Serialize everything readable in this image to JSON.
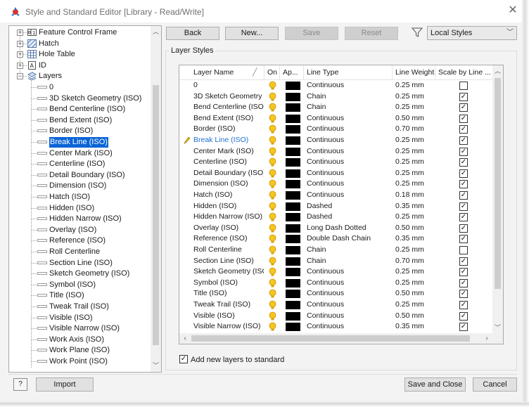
{
  "window": {
    "title": "Style and Standard Editor [Library - Read/Write]",
    "close_glyph": "✕"
  },
  "tree": {
    "groups": [
      {
        "label": "Feature Control Frame",
        "icon": "feature-control-frame-icon"
      },
      {
        "label": "Hatch",
        "icon": "hatch-icon"
      },
      {
        "label": "Hole Table",
        "icon": "hole-table-icon"
      },
      {
        "label": "ID",
        "icon": "id-icon"
      },
      {
        "label": "Layers",
        "icon": "layers-icon"
      }
    ],
    "layer_items": [
      "0",
      "3D Sketch Geometry (ISO)",
      "Bend Centerline (ISO)",
      "Bend Extent (ISO)",
      "Border (ISO)",
      "Break Line (ISO)",
      "Center Mark (ISO)",
      "Centerline (ISO)",
      "Detail Boundary (ISO)",
      "Dimension (ISO)",
      "Hatch (ISO)",
      "Hidden (ISO)",
      "Hidden Narrow (ISO)",
      "Overlay (ISO)",
      "Reference (ISO)",
      "Roll Centerline",
      "Section Line (ISO)",
      "Sketch Geometry (ISO)",
      "Symbol (ISO)",
      "Title (ISO)",
      "Tweak Trail (ISO)",
      "Visible (ISO)",
      "Visible Narrow (ISO)",
      "Work Axis (ISO)",
      "Work Plane (ISO)",
      "Work Point (ISO)"
    ],
    "selected": "Break Line (ISO)"
  },
  "toolbar": {
    "back": "Back",
    "new": "New...",
    "save": "Save",
    "reset": "Reset",
    "filter_value": "Local Styles"
  },
  "layer_styles": {
    "group_label": "Layer Styles",
    "columns": [
      "Layer Name",
      "On",
      "Ap...",
      "Line Type",
      "Line Weight",
      "Scale by Line ..."
    ],
    "active_row": 5,
    "rows": [
      {
        "name": "0",
        "line_type": "Continuous",
        "weight": "0.25 mm",
        "scale": false
      },
      {
        "name": "3D Sketch Geometry (IS",
        "line_type": "Chain",
        "weight": "0.25 mm",
        "scale": true
      },
      {
        "name": "Bend Centerline (ISO)",
        "line_type": "Chain",
        "weight": "0.25 mm",
        "scale": true
      },
      {
        "name": "Bend Extent (ISO)",
        "line_type": "Continuous",
        "weight": "0.50 mm",
        "scale": true
      },
      {
        "name": "Border (ISO)",
        "line_type": "Continuous",
        "weight": "0.70 mm",
        "scale": true
      },
      {
        "name": "Break Line (ISO)",
        "line_type": "Continuous",
        "weight": "0.25 mm",
        "scale": true
      },
      {
        "name": "Center Mark (ISO)",
        "line_type": "Continuous",
        "weight": "0.25 mm",
        "scale": true
      },
      {
        "name": "Centerline (ISO)",
        "line_type": "Continuous",
        "weight": "0.25 mm",
        "scale": true
      },
      {
        "name": "Detail Boundary (ISO)",
        "line_type": "Continuous",
        "weight": "0.25 mm",
        "scale": true
      },
      {
        "name": "Dimension (ISO)",
        "line_type": "Continuous",
        "weight": "0.25 mm",
        "scale": true
      },
      {
        "name": "Hatch (ISO)",
        "line_type": "Continuous",
        "weight": "0.18 mm",
        "scale": true
      },
      {
        "name": "Hidden (ISO)",
        "line_type": "Dashed",
        "weight": "0.35 mm",
        "scale": true
      },
      {
        "name": "Hidden Narrow (ISO)",
        "line_type": "Dashed",
        "weight": "0.25 mm",
        "scale": true
      },
      {
        "name": "Overlay (ISO)",
        "line_type": "Long Dash Dotted",
        "weight": "0.50 mm",
        "scale": true
      },
      {
        "name": "Reference (ISO)",
        "line_type": "Double Dash Chain",
        "weight": "0.35 mm",
        "scale": true
      },
      {
        "name": "Roll Centerline",
        "line_type": "Chain",
        "weight": "0.25 mm",
        "scale": false
      },
      {
        "name": "Section Line (ISO)",
        "line_type": "Chain",
        "weight": "0.70 mm",
        "scale": true
      },
      {
        "name": "Sketch Geometry (ISO)",
        "line_type": "Continuous",
        "weight": "0.25 mm",
        "scale": true
      },
      {
        "name": "Symbol (ISO)",
        "line_type": "Continuous",
        "weight": "0.25 mm",
        "scale": true
      },
      {
        "name": "Title (ISO)",
        "line_type": "Continuous",
        "weight": "0.50 mm",
        "scale": true
      },
      {
        "name": "Tweak Trail (ISO)",
        "line_type": "Continuous",
        "weight": "0.25 mm",
        "scale": true
      },
      {
        "name": "Visible (ISO)",
        "line_type": "Continuous",
        "weight": "0.50 mm",
        "scale": true
      },
      {
        "name": "Visible Narrow (ISO)",
        "line_type": "Continuous",
        "weight": "0.35 mm",
        "scale": true
      }
    ],
    "add_new_label": "Add new layers to standard",
    "add_new_checked": true
  },
  "bottom": {
    "help": "?",
    "import": "Import",
    "save_and_close": "Save and Close",
    "cancel": "Cancel"
  },
  "colors": {
    "selection": "#0a64d6",
    "active_text": "#1f6fd1",
    "bulb": "#f2b705",
    "swatch": "#000000"
  }
}
